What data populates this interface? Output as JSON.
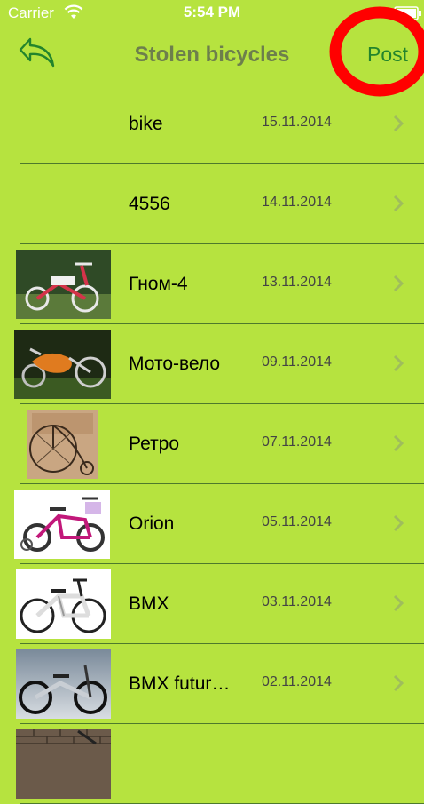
{
  "status_bar": {
    "carrier": "Carrier",
    "time": "5:54 PM"
  },
  "nav": {
    "title": "Stolen bicycles",
    "post_label": "Post",
    "back_icon": "back-arrow-icon"
  },
  "colors": {
    "background": "#b6e33f",
    "title": "#6d7f4c",
    "accent": "#23842c",
    "highlight": "#ff0000"
  },
  "items": [
    {
      "name": "bike",
      "date": "15.11.2014",
      "thumb": "none"
    },
    {
      "name": "4556",
      "date": "14.11.2014",
      "thumb": "none"
    },
    {
      "name": "Гном-4",
      "date": "13.11.2014",
      "thumb": "tricycle"
    },
    {
      "name": "Мото-вело",
      "date": "09.11.2014",
      "thumb": "moto-bike"
    },
    {
      "name": "Ретро",
      "date": "07.11.2014",
      "thumb": "penny-farthing"
    },
    {
      "name": "Orion",
      "date": "05.11.2014",
      "thumb": "kids-bike"
    },
    {
      "name": "BMX",
      "date": "03.11.2014",
      "thumb": "bmx-white"
    },
    {
      "name": "BMX futur…",
      "date": "02.11.2014",
      "thumb": "bmx-future"
    },
    {
      "name": "",
      "date": "",
      "thumb": "brick-wall"
    }
  ]
}
